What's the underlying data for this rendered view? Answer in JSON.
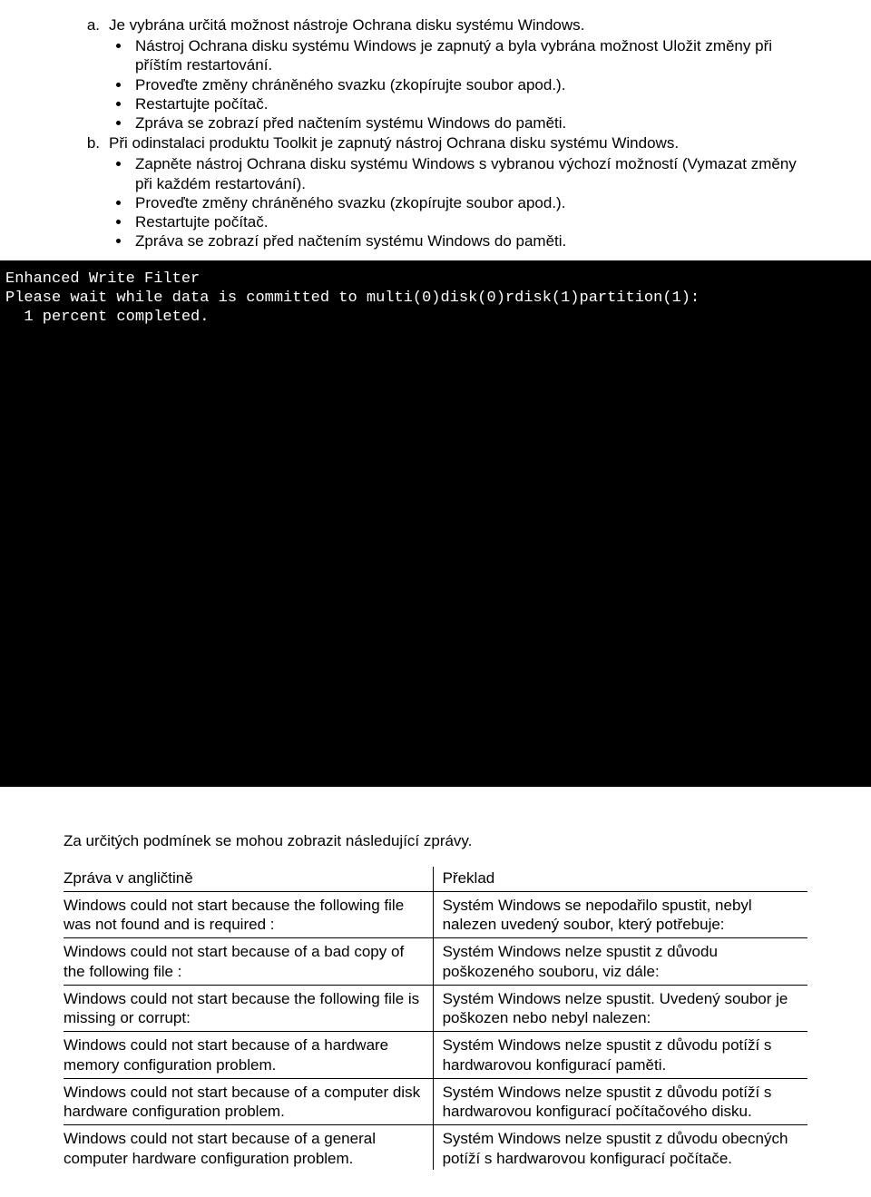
{
  "item_a": {
    "letter": "a.",
    "text": "Je vybrána určitá možnost nástroje Ochrana disku systému Windows.",
    "bullets": [
      "Nástroj Ochrana disku systému Windows je zapnutý a byla vybrána možnost Uložit změny při příštím restartování.",
      "Proveďte změny chráněného svazku (zkopírujte soubor apod.).",
      "Restartujte počítač.",
      "Zpráva se zobrazí před načtením systému Windows do paměti."
    ]
  },
  "item_b": {
    "letter": "b.",
    "text": "Při odinstalaci produktu Toolkit je zapnutý nástroj Ochrana disku systému Windows.",
    "bullets": [
      "Zapněte nástroj Ochrana disku systému Windows s vybranou výchozí možností (Vymazat změny při každém restartování).",
      "Proveďte změny chráněného svazku (zkopírujte soubor apod.).",
      "Restartujte počítač.",
      "Zpráva se zobrazí před načtením systému Windows do paměti."
    ]
  },
  "console": {
    "line1": "Enhanced Write Filter",
    "line2": "Please wait while data is committed to multi(0)disk(0)rdisk(1)partition(1):",
    "line3": "  1 percent completed."
  },
  "bottom_para": "Za určitých podmínek se mohou zobrazit následující zprávy.",
  "table": {
    "head_left": "Zpráva v angličtině",
    "head_right": "Překlad",
    "rows": [
      {
        "left": "Windows could not start because the following file was not found and is required :",
        "right": "Systém Windows se nepodařilo spustit, nebyl nalezen uvedený soubor, který potřebuje:"
      },
      {
        "left": "Windows could not start because of a bad copy of the following file :",
        "right": "Systém Windows nelze spustit z důvodu poškozeného souboru, viz dále:"
      },
      {
        "left": "Windows could not start because the following file is missing or corrupt:",
        "right": "Systém Windows nelze spustit. Uvedený soubor je poškozen nebo nebyl nalezen:"
      },
      {
        "left": "Windows could not start because of a hardware memory configuration problem.",
        "right": "Systém Windows nelze spustit z důvodu potíží s hardwarovou konfigurací paměti."
      },
      {
        "left": "Windows could not start because of a computer disk hardware configuration problem.",
        "right": "Systém Windows nelze spustit z důvodu potíží s hardwarovou konfigurací počítačového disku."
      },
      {
        "left": "Windows could not start because of a general computer hardware configuration problem.",
        "right": "Systém Windows nelze spustit z důvodu obecných potíží s hardwarovou konfigurací počítače."
      }
    ]
  }
}
